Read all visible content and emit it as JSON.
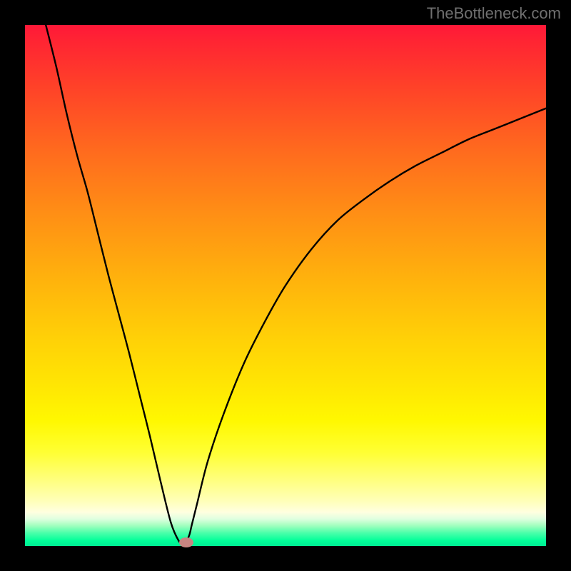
{
  "watermark": "TheBottleneck.com",
  "chart_data": {
    "type": "line",
    "title": "",
    "xlabel": "",
    "ylabel": "",
    "xlim": [
      0,
      100
    ],
    "ylim": [
      0,
      100
    ],
    "series": [
      {
        "name": "curve",
        "x": [
          4,
          6,
          8,
          10,
          12,
          14,
          16,
          18,
          20,
          22,
          24,
          26,
          28,
          29.5,
          30.5,
          31.5,
          32,
          33,
          35,
          38,
          42,
          46,
          50,
          55,
          60,
          65,
          70,
          75,
          80,
          85,
          90,
          95,
          100
        ],
        "y": [
          100,
          92,
          83,
          75,
          68,
          60,
          52,
          44.5,
          37,
          29,
          21,
          12.5,
          4.5,
          1,
          0.2,
          2,
          4,
          8,
          16,
          25,
          35,
          43,
          50,
          57,
          62.5,
          66.5,
          70,
          73,
          75.5,
          78,
          80,
          82,
          84
        ]
      }
    ],
    "marker": {
      "x": 31,
      "y": 0.7,
      "color": "#c98582"
    },
    "gradient_stops": [
      {
        "pos": 0,
        "color": "#ff1838"
      },
      {
        "pos": 12,
        "color": "#ff4228"
      },
      {
        "pos": 36,
        "color": "#ff8e15"
      },
      {
        "pos": 60,
        "color": "#ffd007"
      },
      {
        "pos": 82,
        "color": "#ffff33"
      },
      {
        "pos": 94,
        "color": "#ffffe0"
      },
      {
        "pos": 100,
        "color": "#00ec93"
      }
    ]
  }
}
